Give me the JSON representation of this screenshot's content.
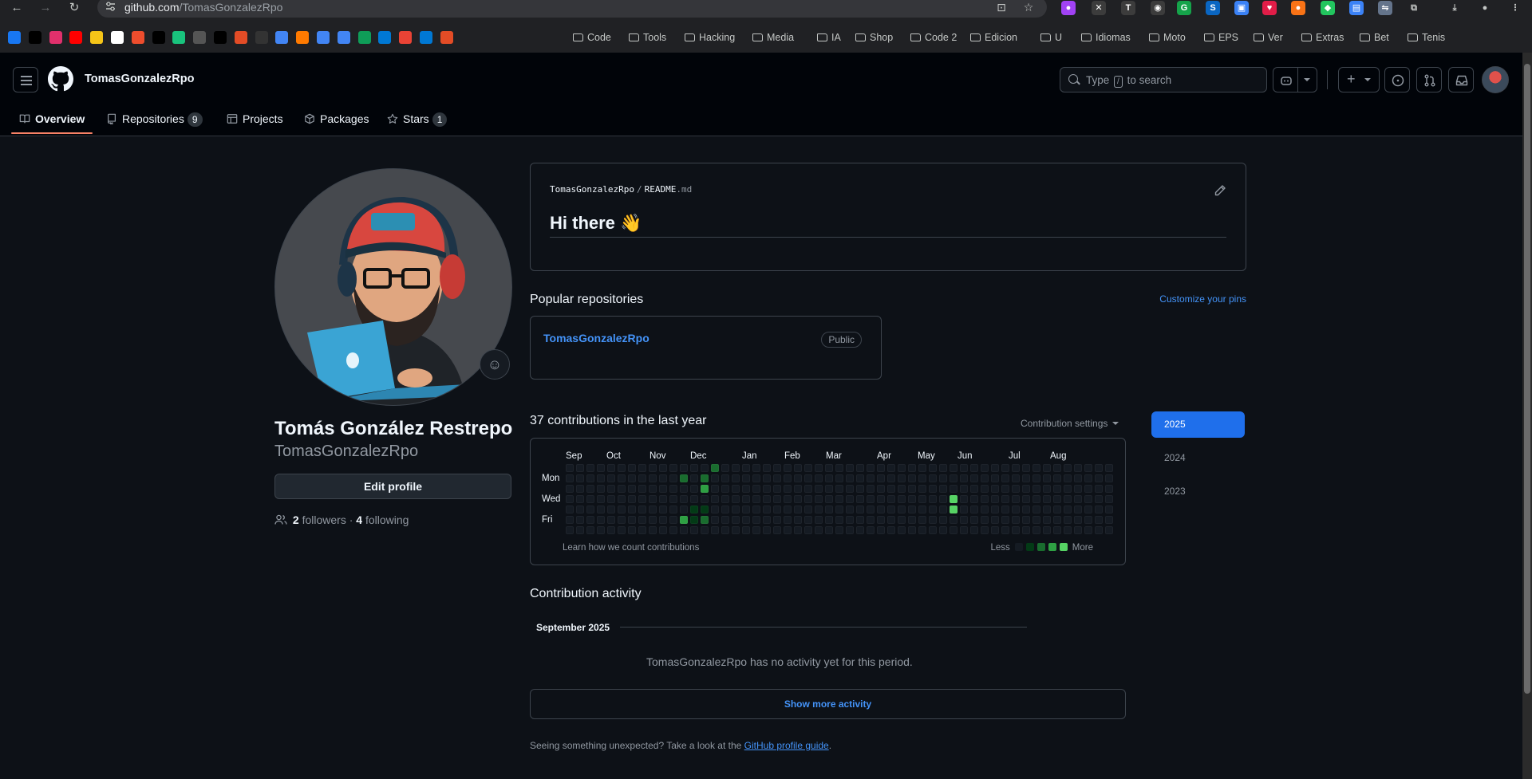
{
  "browser": {
    "url_host": "github.com",
    "url_path": "/TomasGonzalezRpo",
    "extensions": [
      "ia-icon",
      "mute-icon",
      "tp-icon",
      "camera-icon",
      "grammarly-icon",
      "shazam-icon",
      "tabs-icon",
      "pocket-icon",
      "brave-icon",
      "translate-icon",
      "docs-icon",
      "link-icon",
      "puzzle-icon",
      "download-icon",
      "profile-icon",
      "more-icon"
    ],
    "bookmark_folders": [
      "Code",
      "Tools",
      "Hacking",
      "Media",
      "IA",
      "Shop",
      "Code 2",
      "Edicion",
      "U",
      "Idiomas",
      "Moto",
      "EPS",
      "Ver",
      "Extras",
      "Bet",
      "Tenis"
    ]
  },
  "header": {
    "owner": "TomasGonzalezRpo",
    "search_prefix": "Type",
    "search_key": "/",
    "search_suffix": "to search"
  },
  "tabs": [
    {
      "label": "Overview",
      "icon": "book-icon"
    },
    {
      "label": "Repositories",
      "count": "9",
      "icon": "repo-icon"
    },
    {
      "label": "Projects",
      "icon": "table-icon"
    },
    {
      "label": "Packages",
      "icon": "package-icon"
    },
    {
      "label": "Stars",
      "count": "1",
      "icon": "star-icon"
    }
  ],
  "profile": {
    "full_name": "Tomás González Restrepo",
    "login": "TomasGonzalezRpo",
    "edit_button": "Edit profile",
    "followers_count": "2",
    "followers_label": "followers",
    "separator": "·",
    "following_count": "4",
    "following_label": "following"
  },
  "readme": {
    "owner": "TomasGonzalezRpo",
    "slash": "/",
    "file": "README",
    "ext": ".md",
    "heading": "Hi there 👋"
  },
  "popular": {
    "title": "Popular repositories",
    "customize": "Customize your pins",
    "repo_name": "TomasGonzalezRpo",
    "visibility": "Public"
  },
  "contributions": {
    "title": "37 contributions in the last year",
    "settings": "Contribution settings",
    "months": [
      "Sep",
      "Oct",
      "Nov",
      "Dec",
      "Jan",
      "Feb",
      "Mar",
      "Apr",
      "May",
      "Jun",
      "Jul",
      "Aug"
    ],
    "days": [
      "Mon",
      "Wed",
      "Fri"
    ],
    "learn": "Learn how we count contributions",
    "less": "Less",
    "more": "More",
    "levels": [
      "#151b23",
      "#033a16",
      "#196c2e",
      "#2ea043",
      "#56d364"
    ],
    "active_cells": [
      {
        "week": 11,
        "day": 1,
        "level": 2
      },
      {
        "week": 11,
        "day": 5,
        "level": 3
      },
      {
        "week": 12,
        "day": 4,
        "level": 1
      },
      {
        "week": 12,
        "day": 5,
        "level": 1
      },
      {
        "week": 13,
        "day": 1,
        "level": 2
      },
      {
        "week": 13,
        "day": 2,
        "level": 3
      },
      {
        "week": 13,
        "day": 4,
        "level": 1
      },
      {
        "week": 13,
        "day": 5,
        "level": 2
      },
      {
        "week": 14,
        "day": 0,
        "level": 2
      },
      {
        "week": 37,
        "day": 3,
        "level": 4
      },
      {
        "week": 37,
        "day": 4,
        "level": 4
      }
    ]
  },
  "years": [
    "2025",
    "2024",
    "2023"
  ],
  "activity": {
    "title": "Contribution activity",
    "month": "September 2025",
    "empty": "TomasGonzalezRpo has no activity yet for this period.",
    "show_more": "Show more activity",
    "footer_prefix": "Seeing something unexpected? Take a look at the",
    "footer_link": "GitHub profile guide",
    "footer_suffix": "."
  }
}
